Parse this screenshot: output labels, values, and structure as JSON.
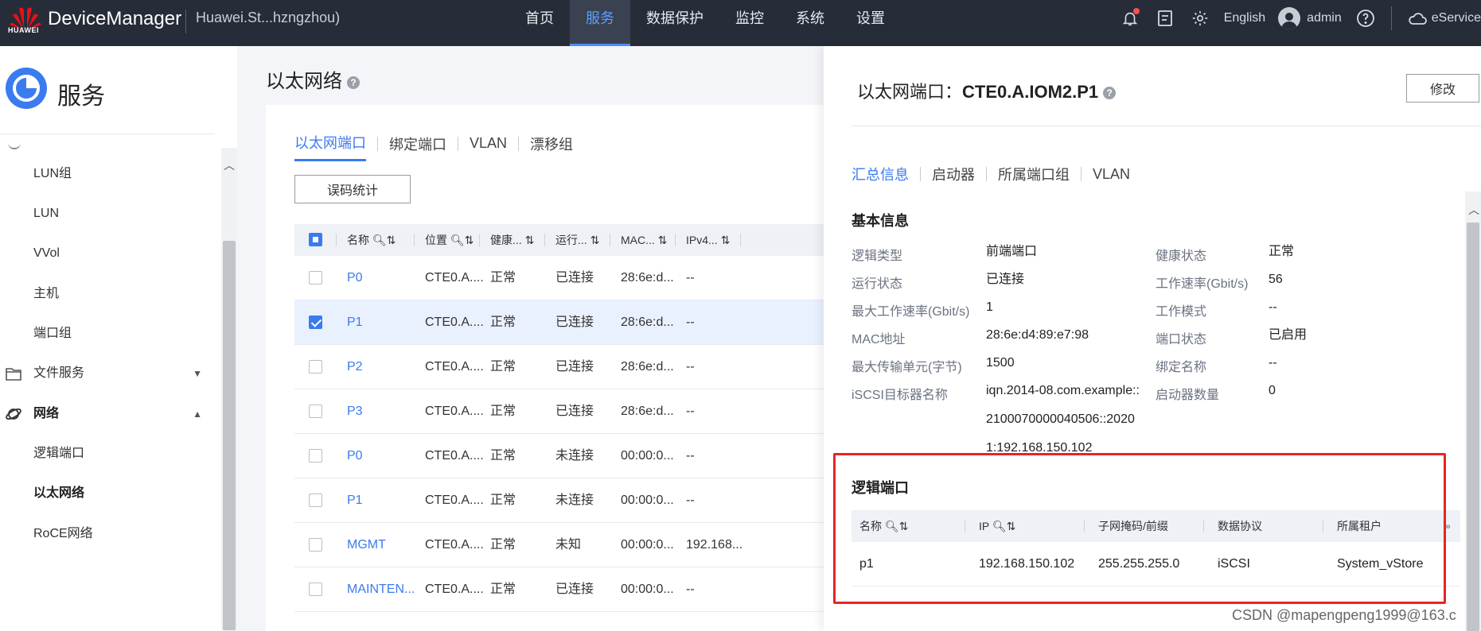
{
  "topbar": {
    "brand": "HUAWEI",
    "app_title": "DeviceManager",
    "device_name": "Huawei.St...hzngzhou)",
    "nav": [
      "首页",
      "服务",
      "数据保护",
      "监控",
      "系统",
      "设置"
    ],
    "nav_active": "服务",
    "language": "English",
    "user": "admin",
    "eservice": "eService"
  },
  "sidebar": {
    "title": "服务",
    "items": [
      {
        "label": "LUN组"
      },
      {
        "label": "LUN"
      },
      {
        "label": "VVol"
      },
      {
        "label": "主机"
      },
      {
        "label": "端口组"
      },
      {
        "label": "文件服务"
      },
      {
        "label": "网络"
      },
      {
        "label": "逻辑端口"
      },
      {
        "label": "以太网络"
      },
      {
        "label": "RoCE网络"
      }
    ]
  },
  "main": {
    "title": "以太网络",
    "tabs": [
      "以太网端口",
      "绑定端口",
      "VLAN",
      "漂移组"
    ],
    "error_stats_button": "误码统计",
    "columns": [
      "名称",
      "位置",
      "健康...",
      "运行...",
      "MAC...",
      "IPv4..."
    ],
    "rows": [
      {
        "name": "P0",
        "location": "CTE0.A....",
        "health": "正常",
        "run": "已连接",
        "mac": "28:6e:d...",
        "ipv4": "--",
        "checked": false
      },
      {
        "name": "P1",
        "location": "CTE0.A....",
        "health": "正常",
        "run": "已连接",
        "mac": "28:6e:d...",
        "ipv4": "--",
        "checked": true
      },
      {
        "name": "P2",
        "location": "CTE0.A....",
        "health": "正常",
        "run": "已连接",
        "mac": "28:6e:d...",
        "ipv4": "--",
        "checked": false
      },
      {
        "name": "P3",
        "location": "CTE0.A....",
        "health": "正常",
        "run": "已连接",
        "mac": "28:6e:d...",
        "ipv4": "--",
        "checked": false
      },
      {
        "name": "P0",
        "location": "CTE0.A....",
        "health": "正常",
        "run": "未连接",
        "mac": "00:00:0...",
        "ipv4": "--",
        "checked": false
      },
      {
        "name": "P1",
        "location": "CTE0.A....",
        "health": "正常",
        "run": "未连接",
        "mac": "00:00:0...",
        "ipv4": "--",
        "checked": false
      },
      {
        "name": "MGMT",
        "location": "CTE0.A....",
        "health": "正常",
        "run": "未知",
        "mac": "00:00:0...",
        "ipv4": "192.168...",
        "checked": false
      },
      {
        "name": "MAINTEN...",
        "location": "CTE0.A....",
        "health": "正常",
        "run": "已连接",
        "mac": "00:00:0...",
        "ipv4": "--",
        "checked": false
      }
    ]
  },
  "drawer": {
    "title_prefix": "以太网端口：",
    "title_name": "CTE0.A.IOM2.P1",
    "edit_button": "修改",
    "tabs": [
      "汇总信息",
      "启动器",
      "所属端口组",
      "VLAN"
    ],
    "basic_title": "基本信息",
    "left_info": [
      {
        "label": "逻辑类型",
        "value": "前端端口"
      },
      {
        "label": "运行状态",
        "value": "已连接"
      },
      {
        "label": "最大工作速率(Gbit/s)",
        "value": "1"
      },
      {
        "label": "MAC地址",
        "value": "28:6e:d4:89:e7:98"
      },
      {
        "label": "最大传输单元(字节)",
        "value": "1500"
      },
      {
        "label": "iSCSI目标器名称",
        "value_lines": [
          "iqn.2014-08.com.example::",
          "2100070000040506::2020",
          "1:192.168.150.102"
        ]
      }
    ],
    "right_info": [
      {
        "label": "健康状态",
        "value": "正常"
      },
      {
        "label": "工作速率(Gbit/s)",
        "value": "56"
      },
      {
        "label": "工作模式",
        "value": "--"
      },
      {
        "label": "端口状态",
        "value": "已启用"
      },
      {
        "label": "绑定名称",
        "value": "--"
      },
      {
        "label": "启动器数量",
        "value": "0"
      }
    ],
    "logical_title": "逻辑端口",
    "logical_columns": [
      "名称",
      "IP",
      "子网掩码/前缀",
      "数据协议",
      "所属租户"
    ],
    "logical_rows": [
      {
        "name": "p1",
        "ip": "192.168.150.102",
        "mask": "255.255.255.0",
        "protocol": "iSCSI",
        "tenant": "System_vStore"
      }
    ]
  },
  "watermark": "CSDN @mapengpeng1999@163.c",
  "colors": {
    "accent": "#3a7bf0",
    "topbar": "#262c38",
    "highlight": "#e82424"
  }
}
